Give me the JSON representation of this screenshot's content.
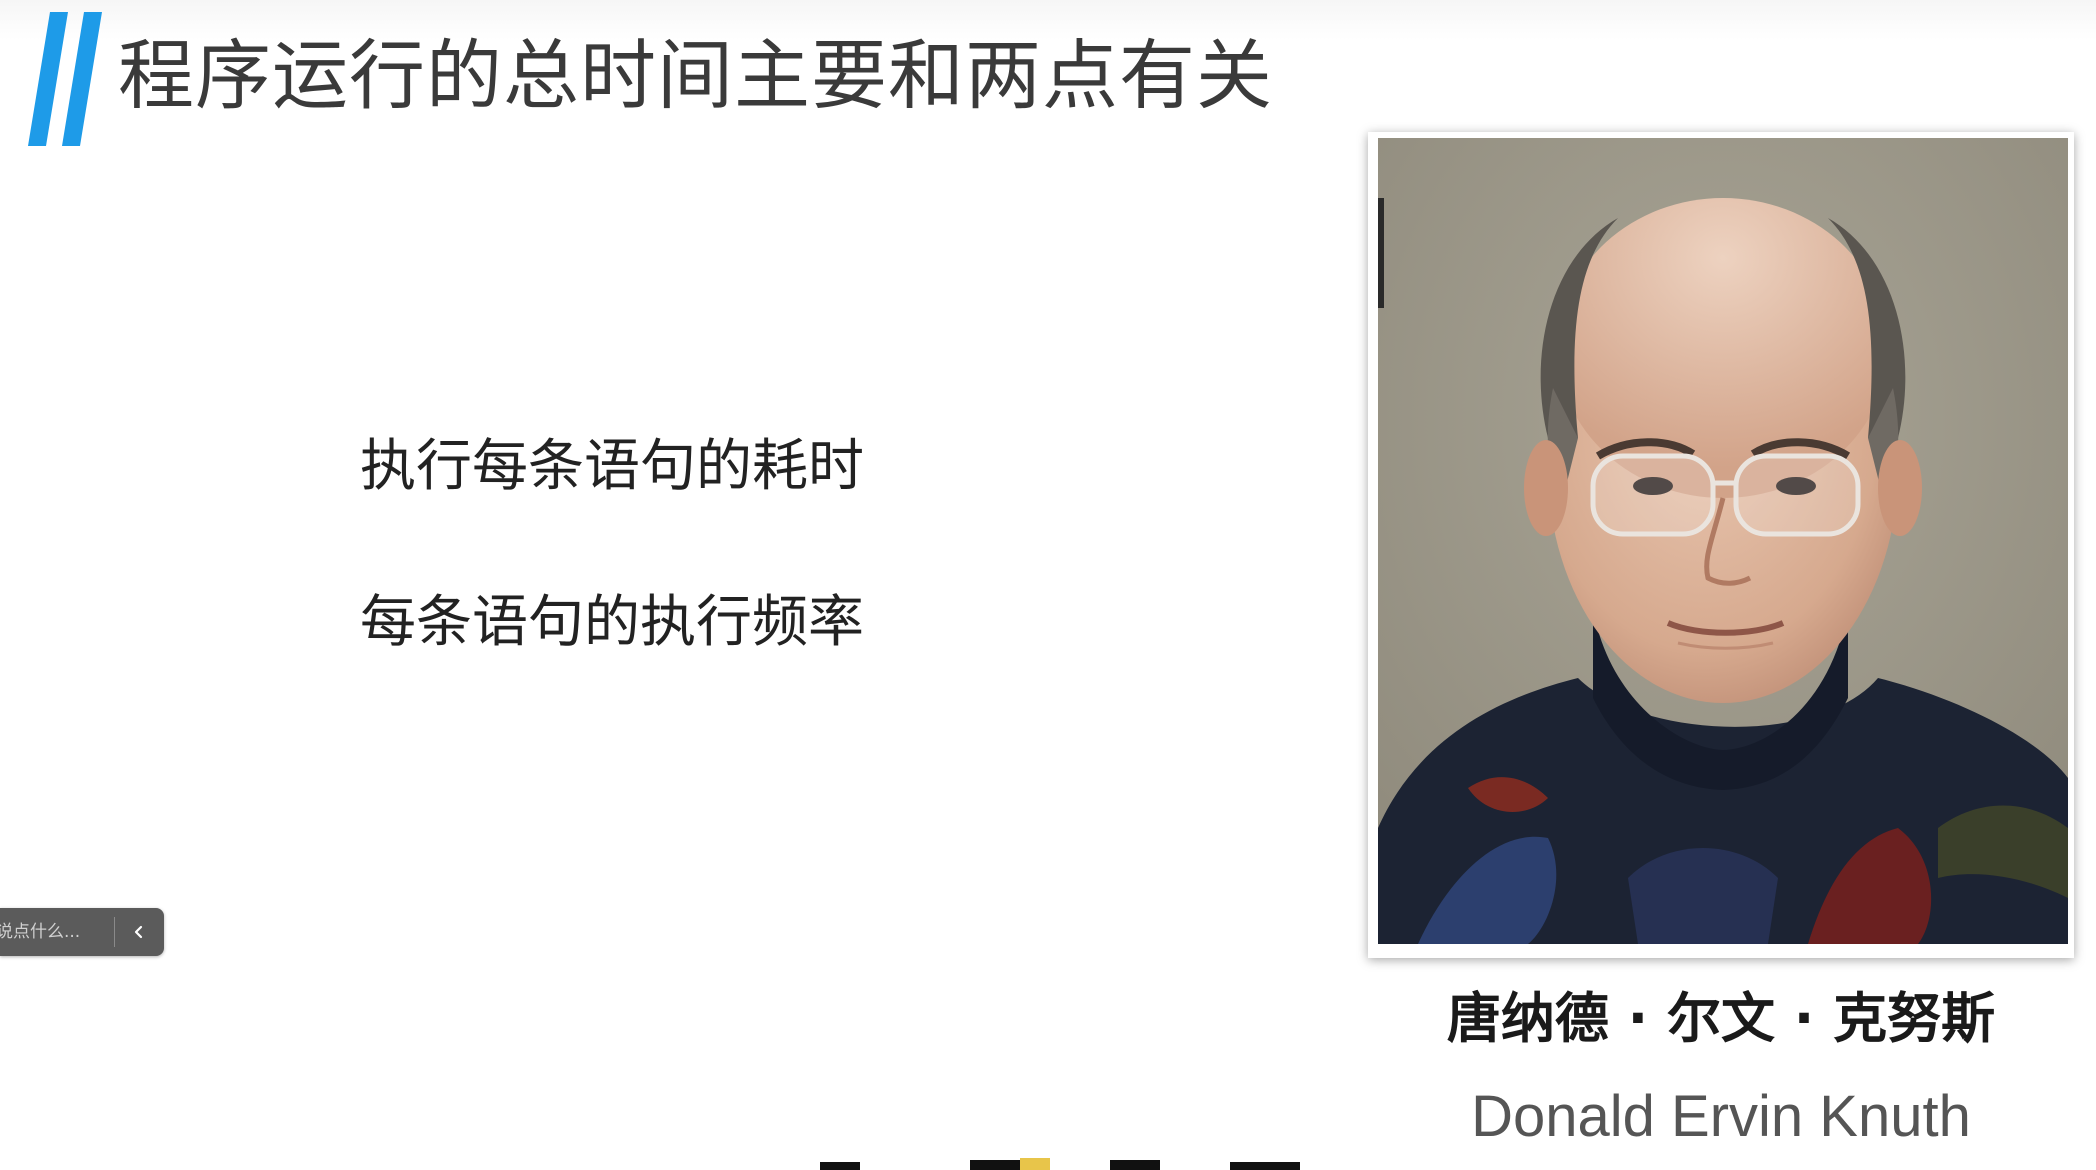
{
  "slide": {
    "title": "程序运行的总时间主要和两点有关",
    "points": [
      "执行每条语句的耗时",
      "每条语句的执行频率"
    ],
    "accent_color": "#1e9be8"
  },
  "portrait": {
    "name_cn": "唐纳德 · 尔文 · 克努斯",
    "name_en": "Donald Ervin Knuth"
  },
  "chat_box": {
    "placeholder": "说点什么...",
    "collapse_icon": "chevron-left-icon"
  }
}
